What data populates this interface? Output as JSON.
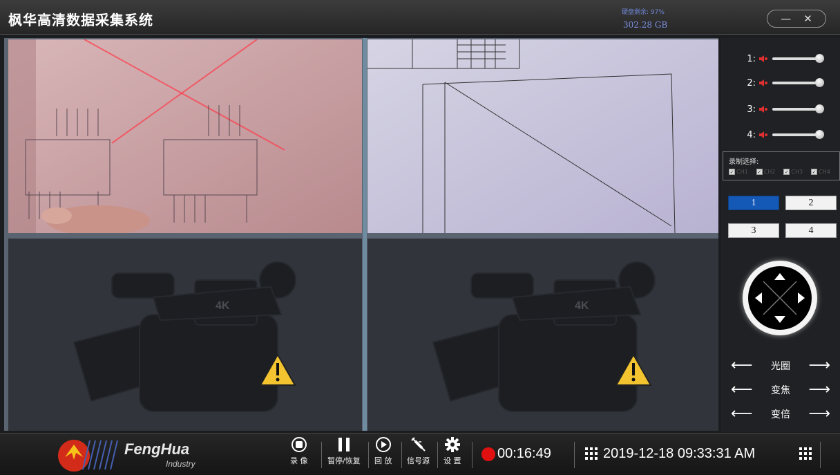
{
  "app": {
    "title": "枫华高清数据采集系统",
    "disk_label": "硬盘剩余: 97%",
    "disk_value": "302.28 GB",
    "minimize_label": "—",
    "close_label": "✕"
  },
  "volume": [
    {
      "label": "1:",
      "level": 1.0
    },
    {
      "label": "2:",
      "level": 1.0
    },
    {
      "label": "3:",
      "level": 1.0
    },
    {
      "label": "4:",
      "level": 1.0
    }
  ],
  "record_select": {
    "label": "录制选择:",
    "channels": [
      "CH1",
      "CH2",
      "CH3",
      "CH4"
    ]
  },
  "layout_buttons": [
    {
      "label": "1",
      "active": true
    },
    {
      "label": "2",
      "active": false
    },
    {
      "label": "3",
      "active": false
    },
    {
      "label": "4",
      "active": false
    }
  ],
  "ptz_controls": [
    {
      "label": "光圈"
    },
    {
      "label": "变焦"
    },
    {
      "label": "变倍"
    }
  ],
  "toolbar": {
    "brand": "FengHua",
    "brand_sub": "Industry",
    "record_label": "录 像",
    "pause_label": "暂停/恢复",
    "playback_label": "回 放",
    "signal_label": "信号源",
    "settings_label": "设 置",
    "timer": "00:16:49",
    "datetime": "2019-12-18 09:33:31 AM"
  },
  "colors": {
    "accent_blue": "#1559b6",
    "record_red": "#e01010",
    "disk_text": "#7b8fe0",
    "warning_yellow": "#f4c430"
  },
  "icons": [
    "record-icon",
    "pause-icon",
    "play-icon",
    "signal-cable-icon",
    "gear-icon",
    "grid-icon",
    "speaker-icon",
    "warning-icon",
    "camera-icon"
  ]
}
